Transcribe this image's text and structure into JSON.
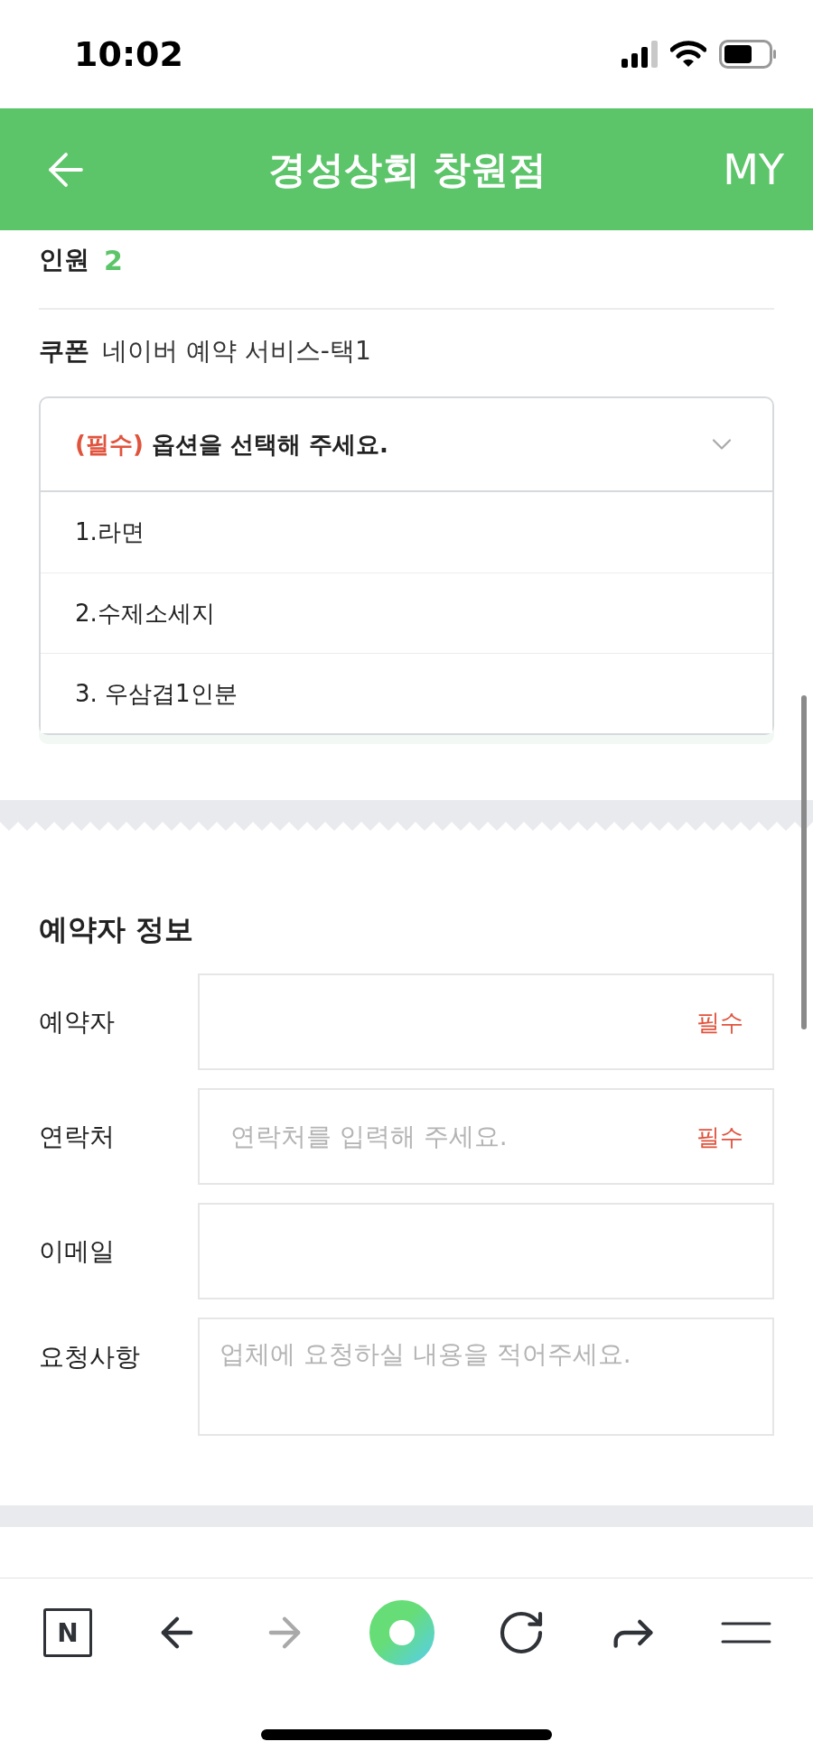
{
  "status_bar": {
    "time": "10:02"
  },
  "header": {
    "title": "경성상회 창원점",
    "my_link": "MY"
  },
  "party": {
    "label": "인원",
    "value": "2"
  },
  "coupon": {
    "label": "쿠폰",
    "name": "네이버 예약 서비스-택1"
  },
  "option_select": {
    "required_tag": "(필수)",
    "placeholder": "옵션을 선택해 주세요.",
    "expanded": true,
    "options": [
      {
        "label": "1.라면",
        "selected": false
      },
      {
        "label": "2.수제소세지",
        "selected": false
      },
      {
        "label": "3. 우삼겹1인분",
        "selected": false
      }
    ]
  },
  "booker": {
    "title": "예약자 정보",
    "fields": [
      {
        "kind": "input",
        "label": "예약자",
        "required_mark": "필수"
      },
      {
        "kind": "input",
        "label": "연락처",
        "placeholder": "연락처를 입력해 주세요.",
        "required_mark": "필수"
      },
      {
        "kind": "input",
        "label": "이메일"
      },
      {
        "kind": "textarea",
        "label": "요청사항",
        "placeholder": "업체에 요청하실 내용을 적어주세요."
      }
    ]
  },
  "toolbar": {
    "buttons": [
      {
        "kind": "logo",
        "label": "N"
      },
      {
        "kind": "back"
      },
      {
        "kind": "forward",
        "disabled": true
      },
      {
        "kind": "home"
      },
      {
        "kind": "reload"
      },
      {
        "kind": "share"
      },
      {
        "kind": "menu"
      }
    ]
  }
}
